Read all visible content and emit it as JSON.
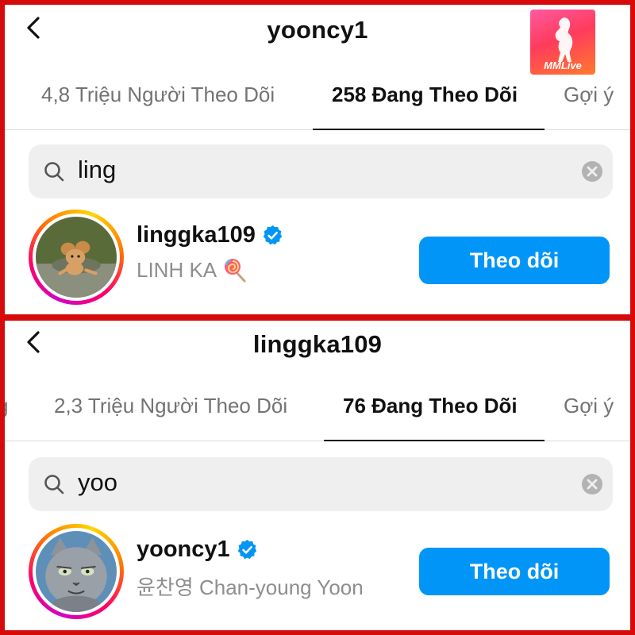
{
  "panels": [
    {
      "title": "yooncy1",
      "tabs": [
        "4,8 Triệu Người Theo Dõi",
        "258 Đang Theo Dõi",
        "Gợi ý"
      ],
      "active_tab": 1,
      "search": {
        "query": "ling"
      },
      "result": {
        "username": "linggka109",
        "fullname": "LINH KA",
        "verified": true,
        "follow_label": "Theo dõi",
        "avatar": "tom-and-jerry-mouse-avatar"
      }
    },
    {
      "title": "linggka109",
      "tabs": [
        "g",
        "2,3 Triệu Người Theo Dõi",
        "76 Đang Theo Dõi",
        "Gợi ý"
      ],
      "active_tab": 2,
      "search": {
        "query": "yoo"
      },
      "result": {
        "username": "yooncy1",
        "fullname": "윤찬영 Chan-young Yoon",
        "verified": true,
        "follow_label": "Theo dõi",
        "avatar": "grey-cartoon-cat-avatar"
      }
    }
  ],
  "watermark": {
    "text": "MMLive"
  },
  "colors": {
    "frame": "#d60a0a",
    "button": "#0095f6",
    "verified": "#0095f6",
    "search_bg": "#efefef"
  }
}
